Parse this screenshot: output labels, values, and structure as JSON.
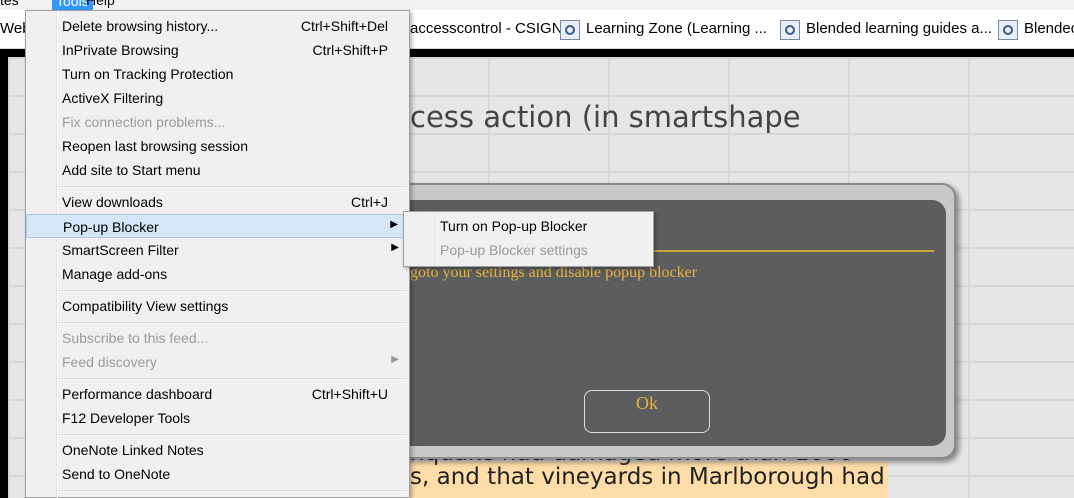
{
  "menubar": {
    "items": [
      "tes",
      "Tools",
      "Help"
    ]
  },
  "favorites": [
    {
      "label": "Web"
    },
    {
      "label": "accesscontrol - CSIGN"
    },
    {
      "label": "Learning Zone (Learning ..."
    },
    {
      "label": "Blended learning guides a..."
    },
    {
      "label": "Blendec"
    }
  ],
  "page": {
    "heading": "cess action (in smartshape",
    "bottom_line1": "nquake had damaged more than 1000",
    "bottom_line2": "s, and that vineyards in Marlborough had"
  },
  "dialog": {
    "message": "goto your settings and disable popup blocker",
    "ok_label": "Ok"
  },
  "tools_menu": {
    "items": [
      {
        "label": "Delete browsing history...",
        "shortcut": "Ctrl+Shift+Del"
      },
      {
        "label": "InPrivate Browsing",
        "shortcut": "Ctrl+Shift+P"
      },
      {
        "label": "Turn on Tracking Protection",
        "shortcut": ""
      },
      {
        "label": "ActiveX Filtering",
        "shortcut": ""
      },
      {
        "label": "Fix connection problems...",
        "shortcut": "",
        "disabled": true
      },
      {
        "label": "Reopen last browsing session",
        "shortcut": ""
      },
      {
        "label": "Add site to Start menu",
        "shortcut": ""
      },
      {
        "label": "View downloads",
        "shortcut": "Ctrl+J"
      },
      {
        "label": "Pop-up Blocker",
        "shortcut": "",
        "submenu": true,
        "highlighted": true
      },
      {
        "label": "SmartScreen Filter",
        "shortcut": "",
        "submenu": true
      },
      {
        "label": "Manage add-ons",
        "shortcut": ""
      },
      {
        "label": "Compatibility View settings",
        "shortcut": ""
      },
      {
        "label": "Subscribe to this feed...",
        "shortcut": "",
        "disabled": true
      },
      {
        "label": "Feed discovery",
        "shortcut": "",
        "submenu": true,
        "disabled": true
      },
      {
        "label": "Performance dashboard",
        "shortcut": "Ctrl+Shift+U"
      },
      {
        "label": "F12 Developer Tools",
        "shortcut": ""
      },
      {
        "label": "OneNote Linked Notes",
        "shortcut": ""
      },
      {
        "label": "Send to OneNote",
        "shortcut": ""
      }
    ]
  },
  "popup_submenu": {
    "items": [
      {
        "label": "Turn on Pop-up Blocker",
        "disabled": false
      },
      {
        "label": "Pop-up Blocker settings",
        "disabled": true
      }
    ]
  },
  "colors": {
    "menu_highlight": "#d5e6f9",
    "dialog_bg": "#5c5d5f",
    "dialog_text": "#e9b33d",
    "disabled_text": "#9a9a9a"
  },
  "icons": {
    "favorite": "site-favicon-icon",
    "submenu_arrow": "chevron-right-icon"
  }
}
